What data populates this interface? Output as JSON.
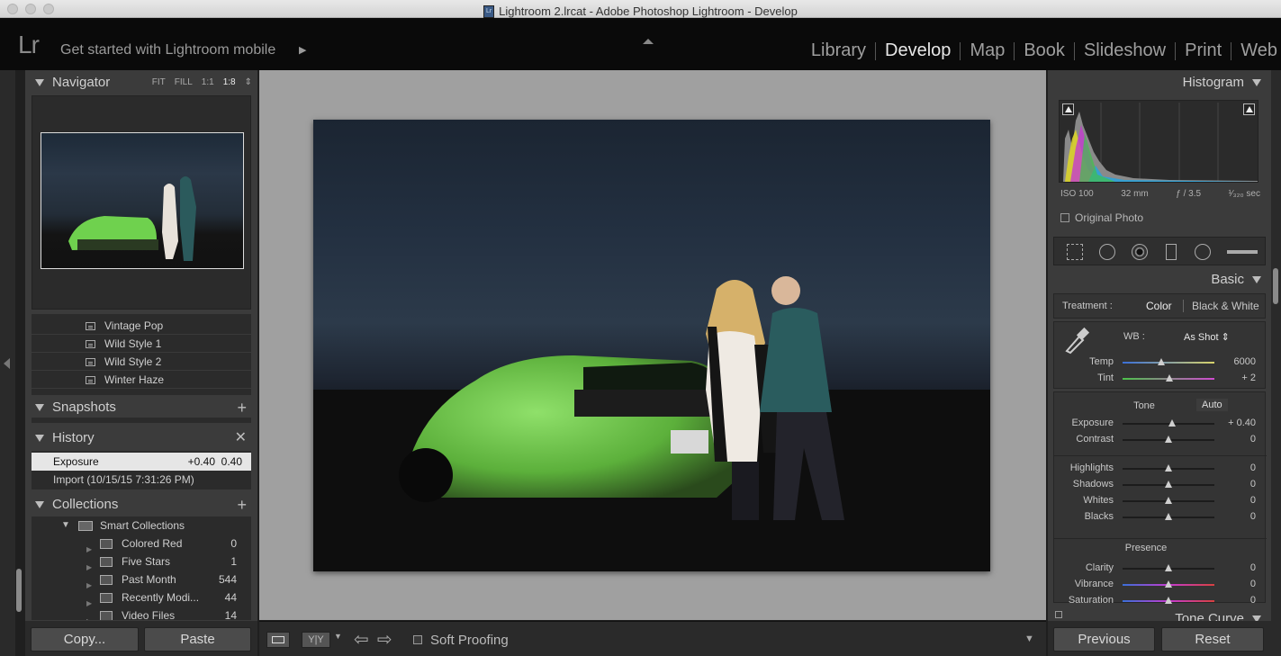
{
  "window": {
    "title": "Lightroom 2.lrcat - Adobe Photoshop Lightroom - Develop",
    "catalog_badge": "Lr"
  },
  "topbar": {
    "logo": "Lr",
    "mobile": "Get started with Lightroom mobile",
    "modules": [
      "Library",
      "Develop",
      "Map",
      "Book",
      "Slideshow",
      "Print",
      "Web"
    ],
    "active_module": "Develop"
  },
  "navigator": {
    "title": "Navigator",
    "options": [
      "FIT",
      "FILL",
      "1:1",
      "1:8"
    ],
    "active_option": "1:8"
  },
  "presets": [
    "Vintage Pop",
    "Wild Style 1",
    "Wild Style 2",
    "Winter Haze"
  ],
  "snapshots": {
    "title": "Snapshots"
  },
  "history": {
    "title": "History",
    "items": [
      {
        "label": "Exposure",
        "v1": "+0.40",
        "v2": "0.40"
      },
      {
        "label": "Import (10/15/15 7:31:26 PM)",
        "v1": "",
        "v2": ""
      }
    ]
  },
  "collections": {
    "title": "Collections",
    "group": "Smart Collections",
    "items": [
      {
        "name": "Colored Red",
        "count": "0"
      },
      {
        "name": "Five Stars",
        "count": "1"
      },
      {
        "name": "Past Month",
        "count": "544"
      },
      {
        "name": "Recently Modi...",
        "count": "44"
      },
      {
        "name": "Video Files",
        "count": "14"
      }
    ]
  },
  "left_buttons": {
    "copy": "Copy...",
    "paste": "Paste"
  },
  "toolbar": {
    "soft_proofing": "Soft Proofing"
  },
  "histogram": {
    "title": "Histogram",
    "iso": "ISO 100",
    "focal": "32 mm",
    "aperture": "ƒ / 3.5",
    "shutter": "¹⁄₃₂₀ sec",
    "original_photo": "Original Photo"
  },
  "basic": {
    "title": "Basic",
    "treatment_label": "Treatment :",
    "treatment_color": "Color",
    "treatment_bw": "Black & White",
    "wb_label": "WB :",
    "wb_value": "As Shot",
    "temp": {
      "label": "Temp",
      "value": "6000",
      "pos": 0.42
    },
    "tint": {
      "label": "Tint",
      "value": "+ 2",
      "pos": 0.51
    },
    "tone_label": "Tone",
    "auto": "Auto",
    "tone": [
      {
        "label": "Exposure",
        "value": "+ 0.40",
        "pos": 0.54
      },
      {
        "label": "Contrast",
        "value": "0",
        "pos": 0.5
      }
    ],
    "tone2": [
      {
        "label": "Highlights",
        "value": "0",
        "pos": 0.5
      },
      {
        "label": "Shadows",
        "value": "0",
        "pos": 0.5
      },
      {
        "label": "Whites",
        "value": "0",
        "pos": 0.5
      },
      {
        "label": "Blacks",
        "value": "0",
        "pos": 0.5
      }
    ],
    "presence_label": "Presence",
    "presence": [
      {
        "label": "Clarity",
        "value": "0",
        "pos": 0.5
      },
      {
        "label": "Vibrance",
        "value": "0",
        "pos": 0.5
      },
      {
        "label": "Saturation",
        "value": "0",
        "pos": 0.5
      }
    ]
  },
  "tone_curve": {
    "title": "Tone Curve"
  },
  "right_buttons": {
    "previous": "Previous",
    "reset": "Reset"
  }
}
